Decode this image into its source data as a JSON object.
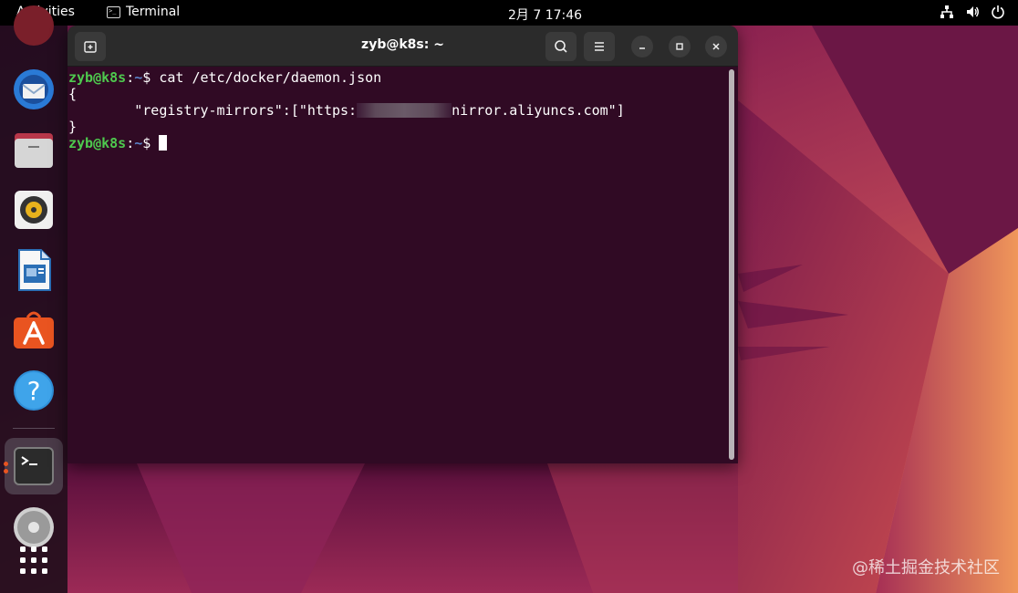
{
  "topbar": {
    "activities_label": "Activities",
    "app_name": "Terminal",
    "clock": "2月 7  17:46",
    "icons": [
      "network-icon",
      "volume-icon",
      "power-icon"
    ]
  },
  "dock": {
    "items": [
      {
        "name": "thunderbird-mail",
        "icon": "mail-icon"
      },
      {
        "name": "files",
        "icon": "folder-icon"
      },
      {
        "name": "rhythmbox",
        "icon": "music-icon"
      },
      {
        "name": "libreoffice-writer",
        "icon": "document-icon"
      },
      {
        "name": "ubuntu-software",
        "icon": "app-store-icon"
      },
      {
        "name": "help",
        "icon": "help-icon"
      },
      {
        "name": "terminal",
        "icon": "terminal-icon",
        "running": true
      },
      {
        "name": "optical-drive",
        "icon": "disc-icon"
      },
      {
        "name": "show-applications",
        "icon": "app-grid-icon"
      }
    ]
  },
  "window": {
    "title": "zyb@k8s: ~",
    "buttons": [
      "new-tab-icon",
      "search-icon",
      "menu-icon",
      "minimize-icon",
      "maximize-icon",
      "close-icon"
    ]
  },
  "terminal": {
    "prompt_user": "zyb@k8s",
    "prompt_sep": ":",
    "prompt_path": "~",
    "prompt_symbol": "$ ",
    "command": "cat /etc/docker/daemon.json",
    "output": {
      "line1": "{",
      "line2_before": "        \"registry-mirrors\":[\"https:",
      "line2_after": "nirror.aliyuncs.com\"]",
      "line3": "}"
    }
  },
  "watermark": "@稀土掘金技术社区",
  "colors": {
    "terminal_bg": "#300a24",
    "prompt_user": "#4ec94e",
    "prompt_path": "#5b84c9",
    "accent": "#e95420"
  }
}
